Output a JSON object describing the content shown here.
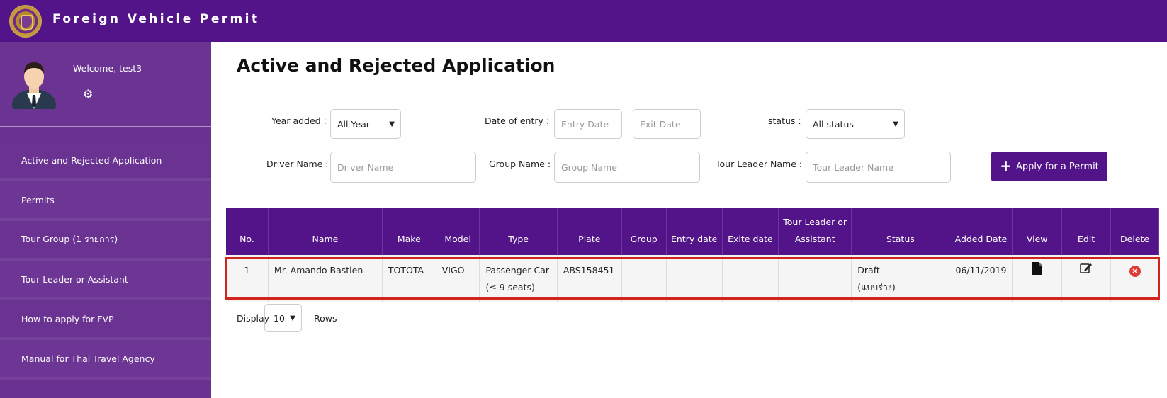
{
  "header": {
    "title": "Foreign Vehicle Permit"
  },
  "sidebar": {
    "welcome": "Welcome, test3",
    "items": [
      {
        "label": "Active and Rejected Application"
      },
      {
        "label": "Permits"
      },
      {
        "label": "Tour Group (1 รายการ)"
      },
      {
        "label": "Tour Leader or Assistant"
      },
      {
        "label": "How to apply for FVP"
      },
      {
        "label": "Manual for Thai Travel Agency"
      }
    ]
  },
  "main": {
    "title": "Active and Rejected Application",
    "filters": {
      "year_label": "Year added :",
      "year_value": "All Year",
      "entry_label": "Date of entry :",
      "entry_placeholder": "Entry Date",
      "exit_placeholder": "Exit Date",
      "status_label": "status :",
      "status_value": "All status",
      "driver_label": "Driver Name :",
      "driver_placeholder": "Driver Name",
      "group_label": "Group Name :",
      "group_placeholder": "Group Name",
      "leader_label": "Tour Leader Name :",
      "leader_placeholder": "Tour Leader Name"
    },
    "apply_button": "Apply for a Permit",
    "table": {
      "headers": [
        "No.",
        "Name",
        "Make",
        "Model",
        "Type",
        "Plate",
        "Group",
        "Entry date",
        "Exite date",
        "Tour Leader or Assistant",
        "Status",
        "Added Date",
        "View",
        "Edit",
        "Delete"
      ],
      "rows": [
        {
          "no": "1",
          "name": "Mr. Amando Bastien",
          "make": "TOTOTA",
          "model": "VIGO",
          "type_line1": "Passenger Car",
          "type_line2": "(≤ 9 seats)",
          "plate": "ABS158451",
          "group": "",
          "entry_date": "",
          "exit_date": "",
          "tour_leader": "",
          "status_line1": "Draft",
          "status_line2": "(แบบร่าง)",
          "added_date": "06/11/2019"
        }
      ]
    },
    "display": {
      "label": "Display",
      "value": "10",
      "rows_label": "Rows"
    }
  }
}
